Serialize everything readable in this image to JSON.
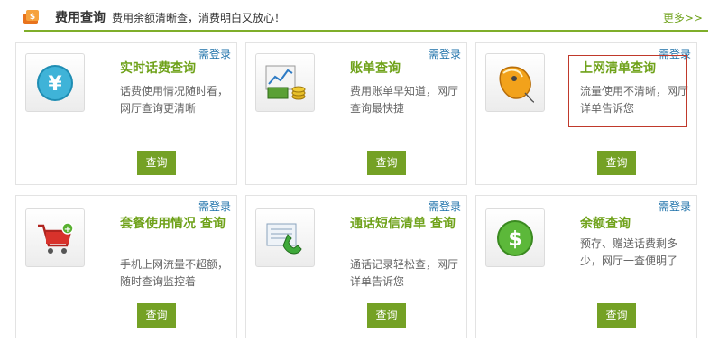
{
  "header": {
    "title": "费用查询",
    "subtitle": "费用余额清晰查，消费明白又放心！",
    "more": "更多>>",
    "logo_icon": "coin-stack-icon"
  },
  "colors": {
    "accent_green": "#74a125",
    "link_blue": "#1a6fa8",
    "highlight_red": "#c0392b"
  },
  "cards": [
    {
      "login": "需登录",
      "title": "实时话费查询",
      "desc": "话费使用情况随时看，网厅查询更清晰",
      "button": "查询",
      "icon": "yen-circle-icon"
    },
    {
      "login": "需登录",
      "title": "账单查询",
      "desc": "费用账单早知道，网厅查询最快捷",
      "button": "查询",
      "icon": "bill-chart-money-icon"
    },
    {
      "login": "需登录",
      "title": "上网清单查询",
      "desc": "流量使用不清晰，网厅详单告诉您",
      "button": "查询",
      "icon": "mouse-icon"
    },
    {
      "login": "需登录",
      "title": "套餐使用情况 查询",
      "desc": "手机上网流量不超额，随时查询监控着",
      "button": "查询",
      "icon": "shopping-cart-icon"
    },
    {
      "login": "需登录",
      "title": "通话短信清单 查询",
      "desc": "通话记录轻松查，网厅详单告诉您",
      "button": "查询",
      "icon": "phone-list-icon"
    },
    {
      "login": "需登录",
      "title": "余额查询",
      "desc": "预存、赠送话费剩多少，网厅一查便明了",
      "button": "查询",
      "icon": "dollar-circle-icon"
    }
  ]
}
